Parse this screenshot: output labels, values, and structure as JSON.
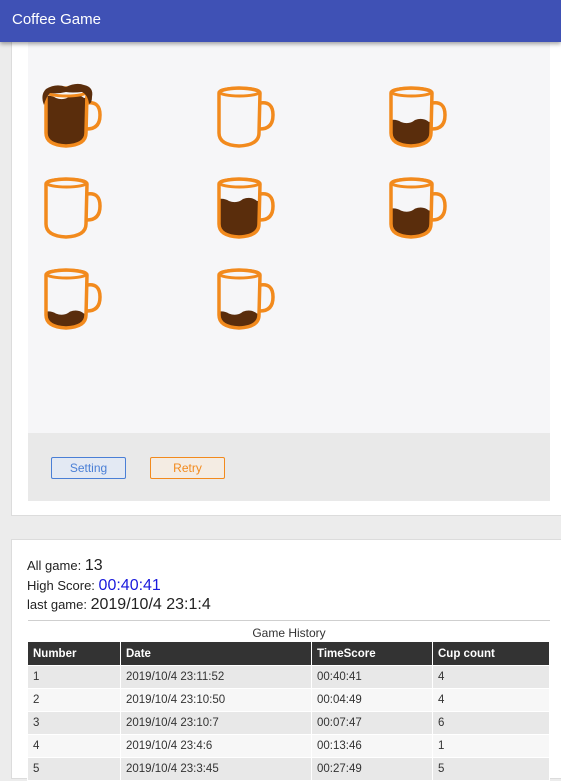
{
  "app": {
    "title": "Coffee Game"
  },
  "cups": [
    {
      "fill": 1.0,
      "overflow": true
    },
    {
      "fill": 0.0,
      "overflow": false
    },
    {
      "fill": 0.5,
      "overflow": false
    },
    {
      "fill": 0.0,
      "overflow": false
    },
    {
      "fill": 0.75,
      "overflow": false
    },
    {
      "fill": 0.55,
      "overflow": false
    },
    {
      "fill": 0.3,
      "overflow": false
    },
    {
      "fill": 0.3,
      "overflow": false
    }
  ],
  "controls": {
    "setting_label": "Setting",
    "retry_label": "Retry"
  },
  "stats": {
    "all_game_label": "All game:",
    "all_game_value": "13",
    "high_score_label": "High Score:",
    "high_score_value": "00:40:41",
    "last_game_label": "last game:",
    "last_game_value": "2019/10/4 23:1:4"
  },
  "history": {
    "caption": "Game History",
    "columns": [
      "Number",
      "Date",
      "TimeScore",
      "Cup count"
    ],
    "rows": [
      [
        "1",
        "2019/10/4 23:11:52",
        "00:40:41",
        "4"
      ],
      [
        "2",
        "2019/10/4 23:10:50",
        "00:04:49",
        "4"
      ],
      [
        "3",
        "2019/10/4 23:10:7",
        "00:07:47",
        "6"
      ],
      [
        "4",
        "2019/10/4 23:4:6",
        "00:13:46",
        "1"
      ],
      [
        "5",
        "2019/10/4 23:3:45",
        "00:27:49",
        "5"
      ]
    ]
  },
  "colors": {
    "primary": "#3f51b5",
    "cup_orange": "#f28a1d",
    "coffee": "#5a2d0c",
    "high_score": "#1a1adc"
  }
}
